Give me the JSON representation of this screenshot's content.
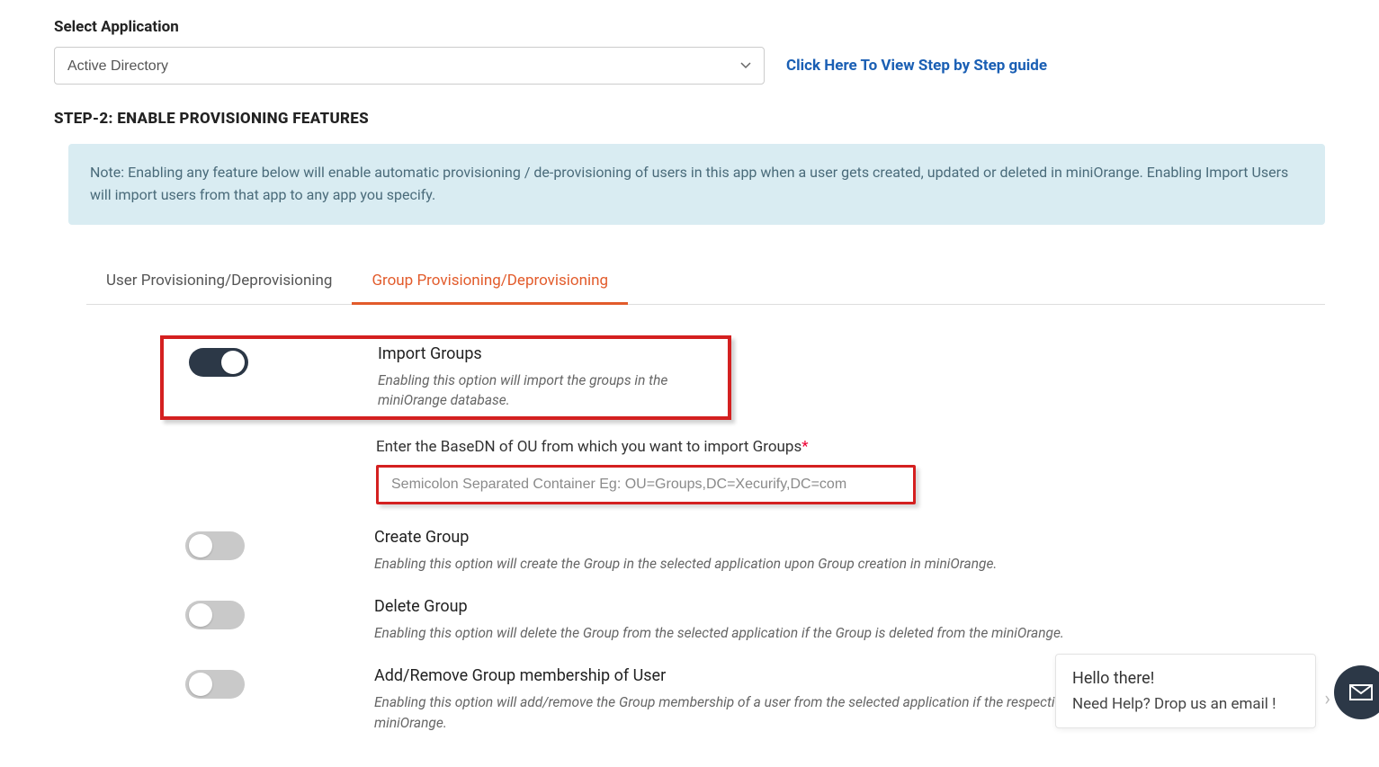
{
  "selectApp": {
    "label": "Select Application",
    "value": "Active Directory"
  },
  "guideLink": "Click Here To View Step by Step guide",
  "stepHeading": "STEP-2: ENABLE PROVISIONING FEATURES",
  "note": "Note: Enabling any feature below will enable automatic provisioning / de-provisioning of users in this app when a user gets created, updated or deleted in miniOrange. Enabling Import Users will import users from that app to any app you specify.",
  "tabs": {
    "user": "User Provisioning/Deprovisioning",
    "group": "Group Provisioning/Deprovisioning"
  },
  "features": {
    "importGroups": {
      "title": "Import Groups",
      "desc": "Enabling this option will import the groups in the miniOrange database.",
      "baseDnLabel": "Enter the BaseDN of OU from which you want to import Groups",
      "baseDnPlaceholder": "Semicolon Separated Container Eg: OU=Groups,DC=Xecurify,DC=com"
    },
    "createGroup": {
      "title": "Create Group",
      "desc": "Enabling this option will create the Group in the selected application upon Group creation in miniOrange."
    },
    "deleteGroup": {
      "title": "Delete Group",
      "desc": "Enabling this option will delete the Group from the selected application if the Group is deleted from the miniOrange."
    },
    "memberGroup": {
      "title": "Add/Remove Group membership of User",
      "desc": "Enabling this option will add/remove the Group membership of a user from the selected application if the respective user's Group is updated from the miniOrange."
    }
  },
  "chat": {
    "greet": "Hello there!",
    "help": "Need Help? Drop us an email !"
  }
}
